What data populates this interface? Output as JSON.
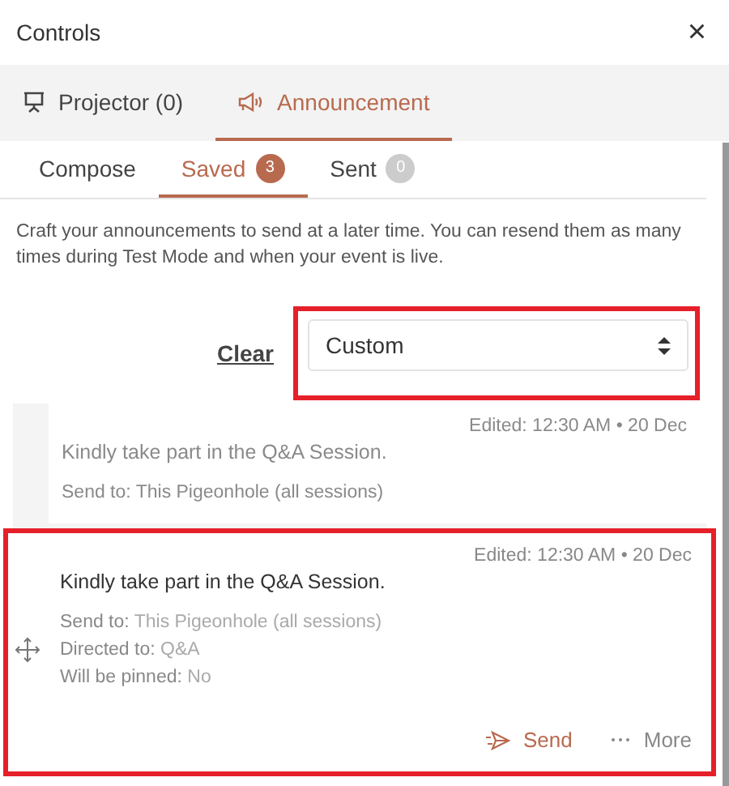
{
  "panel": {
    "title": "Controls",
    "close": "×"
  },
  "tabs": [
    {
      "label": "Projector (0)",
      "kind": "projector",
      "selected": false
    },
    {
      "label": "Announcement",
      "kind": "megaphone",
      "selected": true
    }
  ],
  "subtabs": [
    {
      "label": "Compose",
      "selected": false
    },
    {
      "label": "Saved",
      "badge": "3",
      "selected": true
    },
    {
      "label": "Sent",
      "badge": "0",
      "selected": false
    }
  ],
  "description": "Craft your announcements to send at a later time. You can resend them as many times during Test Mode and when your event is live.",
  "filter": {
    "clear": "Clear",
    "value": "Custom",
    "highlighted": true
  },
  "cards": [
    {
      "faded": true,
      "highlighted": false,
      "edited": "Edited: 12:30 AM • 20 Dec",
      "message": "Kindly take part in the Q&A Session.",
      "details": [
        {
          "label": "Send to:",
          "value": "This Pigeonhole (all sessions)"
        }
      ]
    },
    {
      "faded": false,
      "highlighted": true,
      "edited": "Edited: 12:30 AM • 20 Dec",
      "message": "Kindly take part in the Q&A Session.",
      "details": [
        {
          "label": "Send to:",
          "value": "This Pigeonhole (all sessions)"
        },
        {
          "label": "Directed to:",
          "value": "Q&A"
        },
        {
          "label": "Will be pinned:",
          "value": "No"
        }
      ],
      "actions": [
        {
          "kind": "send",
          "label": "Send"
        },
        {
          "kind": "more",
          "label": "More"
        }
      ]
    }
  ]
}
